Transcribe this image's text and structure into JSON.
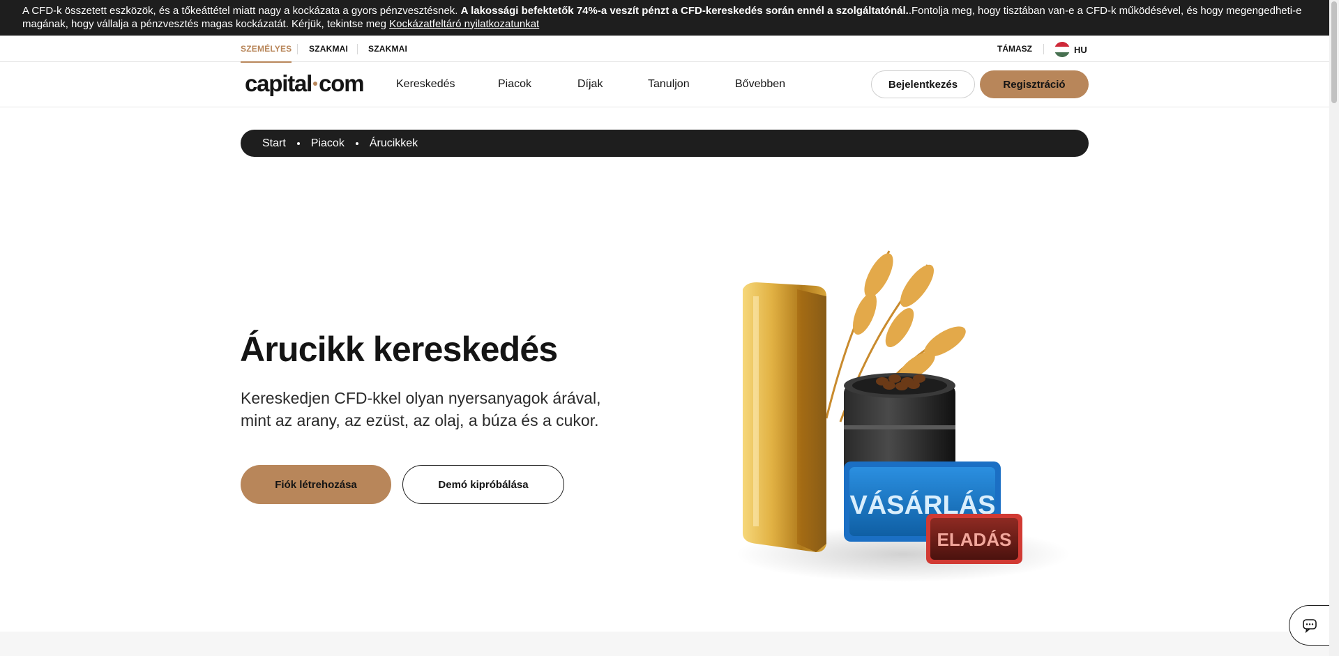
{
  "risk_warning": {
    "text_before": "A CFD-k összetett eszközök, és a tőkeáttétel miatt nagy a kockázata a gyors pénzvesztésnek. ",
    "text_bold": "A lakossági befektetők 74%-a veszít pénzt a CFD-kereskedés során ennél a szolgáltatónál.",
    "text_after": ".Fontolja meg, hogy tisztában van-e a CFD-k működésével, és hogy megengedheti-e magának, hogy vállalja a pénzvesztés magas kockázatát. Kérjük, tekintse meg ",
    "link": "Kockázatfeltáró nyilatkozatunkat"
  },
  "topbar": {
    "segments": [
      "SZEMÉLYES",
      "SZAKMAI",
      "SZAKMAI"
    ],
    "support": "TÁMASZ",
    "language": "HU"
  },
  "nav": {
    "logo_left": "capital",
    "logo_right": "com",
    "items": [
      "Kereskedés",
      "Piacok",
      "Díjak",
      "Tanuljon",
      "Bővebben"
    ],
    "login": "Bejelentkezés",
    "register": "Regisztráció"
  },
  "breadcrumb": [
    "Start",
    "Piacok",
    "Árucikkek"
  ],
  "hero": {
    "title": "Árucikk kereskedés",
    "subtitle": "Kereskedjen CFD-kkel olyan nyersanyagok árával, mint az arany, az ezüst, az olaj, a búza és a cukor.",
    "primary_button": "Fiók létrehozása",
    "secondary_button": "Demó kipróbálása",
    "art_buy": "VÁSÁRLÁS",
    "art_sell": "ELADÁS"
  },
  "colors": {
    "accent": "#b8865a",
    "dark": "#1e1e1e",
    "buy": "#2f8fd8",
    "sell": "#c9302c"
  }
}
